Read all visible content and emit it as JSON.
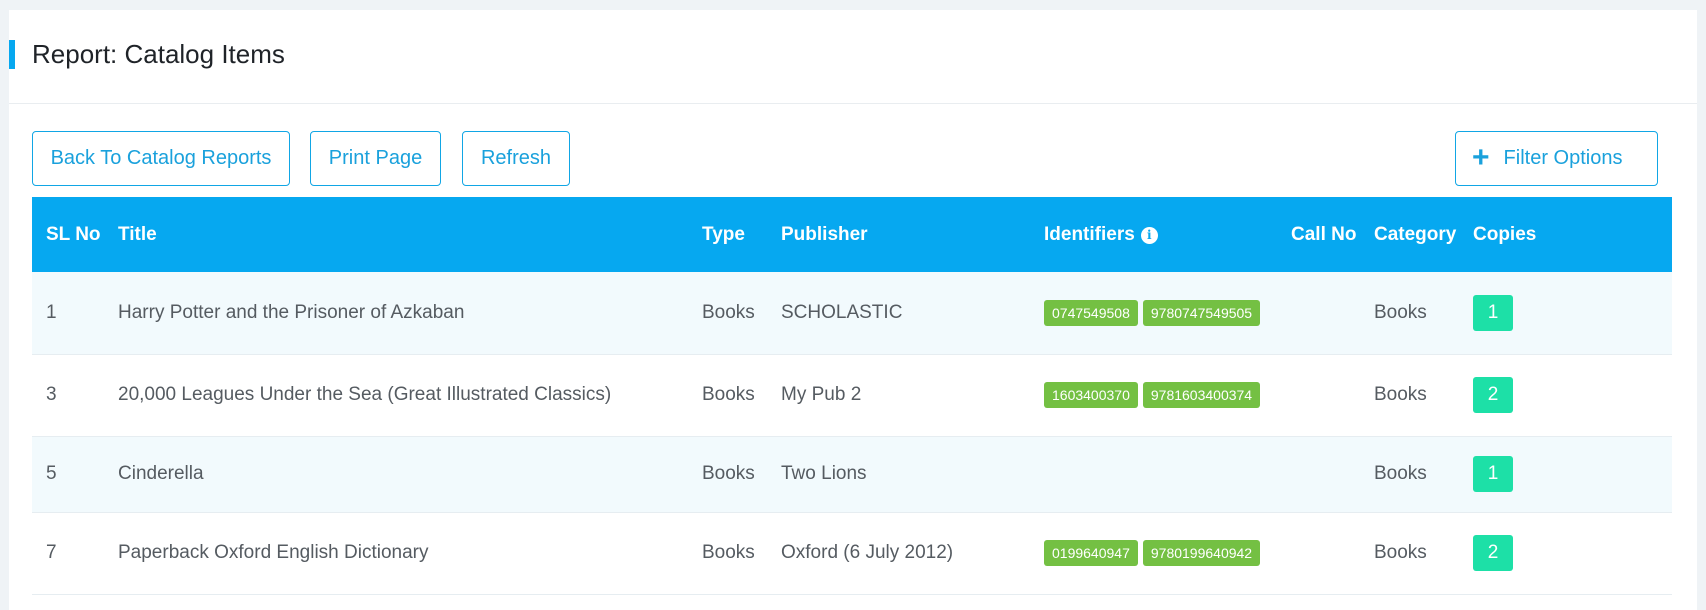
{
  "header": {
    "title": "Report: Catalog Items"
  },
  "toolbar": {
    "back_label": "Back To Catalog Reports",
    "print_label": "Print Page",
    "refresh_label": "Refresh",
    "filter_label": "Filter Options",
    "filter_icon": "+"
  },
  "colors": {
    "accent": "#06a8f0",
    "identifier_badge": "#74c043",
    "copies_badge": "#1de0a7"
  },
  "table": {
    "columns": [
      "SL No",
      "Title",
      "Type",
      "Publisher",
      "Identifiers",
      "Call No",
      "Category",
      "Copies"
    ],
    "identifiers_info_icon": "i",
    "rows": [
      {
        "sl_no": "1",
        "title": "Harry Potter and the Prisoner of Azkaban",
        "type": "Books",
        "publisher": "SCHOLASTIC",
        "identifiers": [
          "0747549508",
          "9780747549505"
        ],
        "call_no": "",
        "category": "Books",
        "copies": "1"
      },
      {
        "sl_no": "3",
        "title": "20,000 Leagues Under the Sea (Great Illustrated Classics)",
        "type": "Books",
        "publisher": "My Pub 2",
        "identifiers": [
          "1603400370",
          "9781603400374"
        ],
        "call_no": "",
        "category": "Books",
        "copies": "2"
      },
      {
        "sl_no": "5",
        "title": "Cinderella",
        "type": "Books",
        "publisher": "Two Lions",
        "identifiers": [],
        "call_no": "",
        "category": "Books",
        "copies": "1"
      },
      {
        "sl_no": "7",
        "title": "Paperback Oxford English Dictionary",
        "type": "Books",
        "publisher": "Oxford (6 July 2012)",
        "identifiers": [
          "0199640947",
          "9780199640942"
        ],
        "call_no": "",
        "category": "Books",
        "copies": "2"
      }
    ]
  }
}
